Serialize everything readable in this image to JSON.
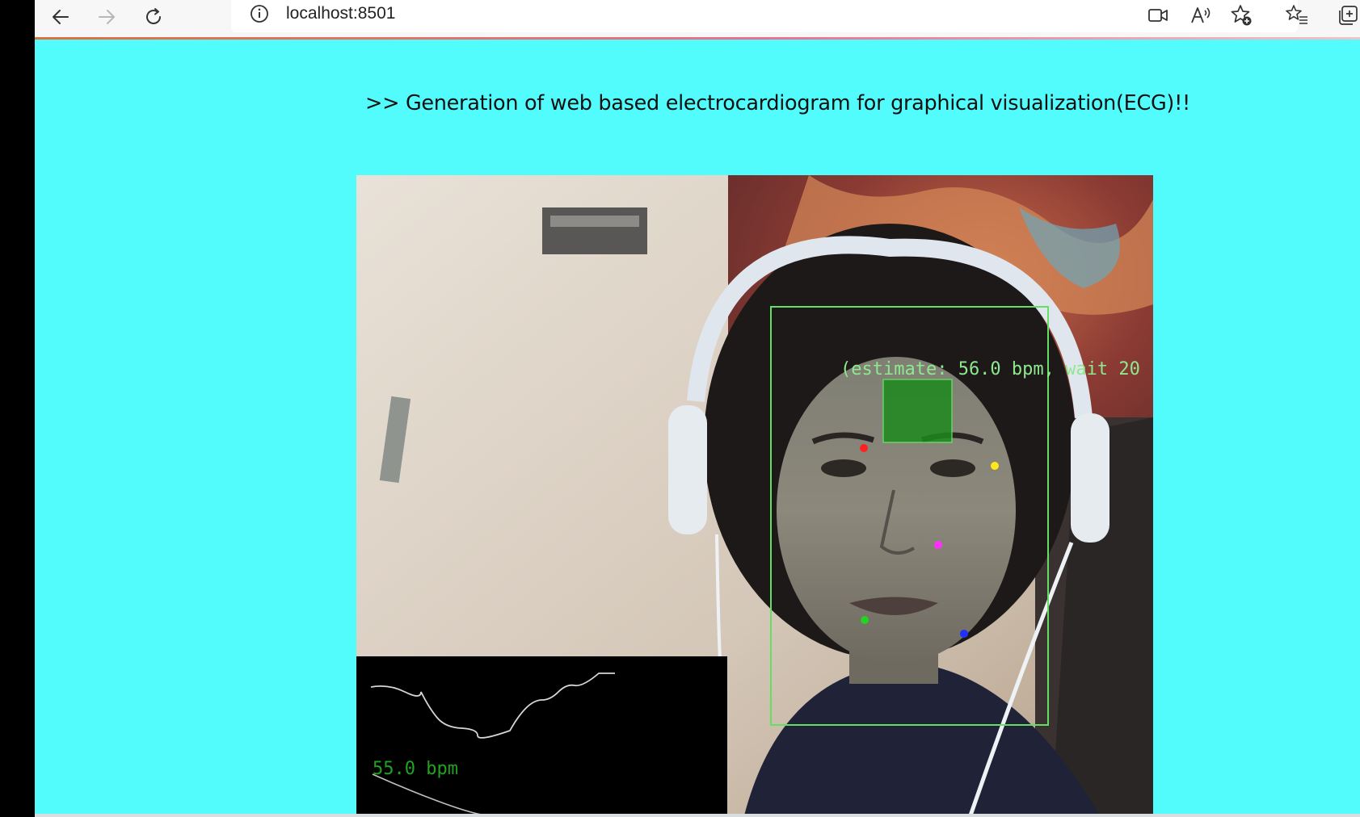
{
  "browser": {
    "url": "localhost:8501",
    "icons": {
      "back": "arrow-left-icon",
      "forward": "arrow-right-icon",
      "reload": "reload-icon",
      "info": "info-icon",
      "camera": "video-camera-icon",
      "read_aloud": "read-aloud-icon",
      "add_favorite": "star-plus-icon",
      "favorites": "favorites-list-icon",
      "collections": "collections-icon"
    }
  },
  "page": {
    "heading": ">> Generation of web based electrocardiogram for graphical visualization(ECG)!!",
    "background_color": "#52fcfc"
  },
  "video": {
    "estimate_label": "(estimate: 56.0 bpm, wait 20",
    "bpm_label": "55.0 bpm",
    "face_box_color": "#63e063",
    "forehead_box_color": "#1d8a1d",
    "landmark_colors": [
      "#ff2020",
      "#ffe81a",
      "#ff30ff",
      "#22d422",
      "#2030ff"
    ]
  }
}
